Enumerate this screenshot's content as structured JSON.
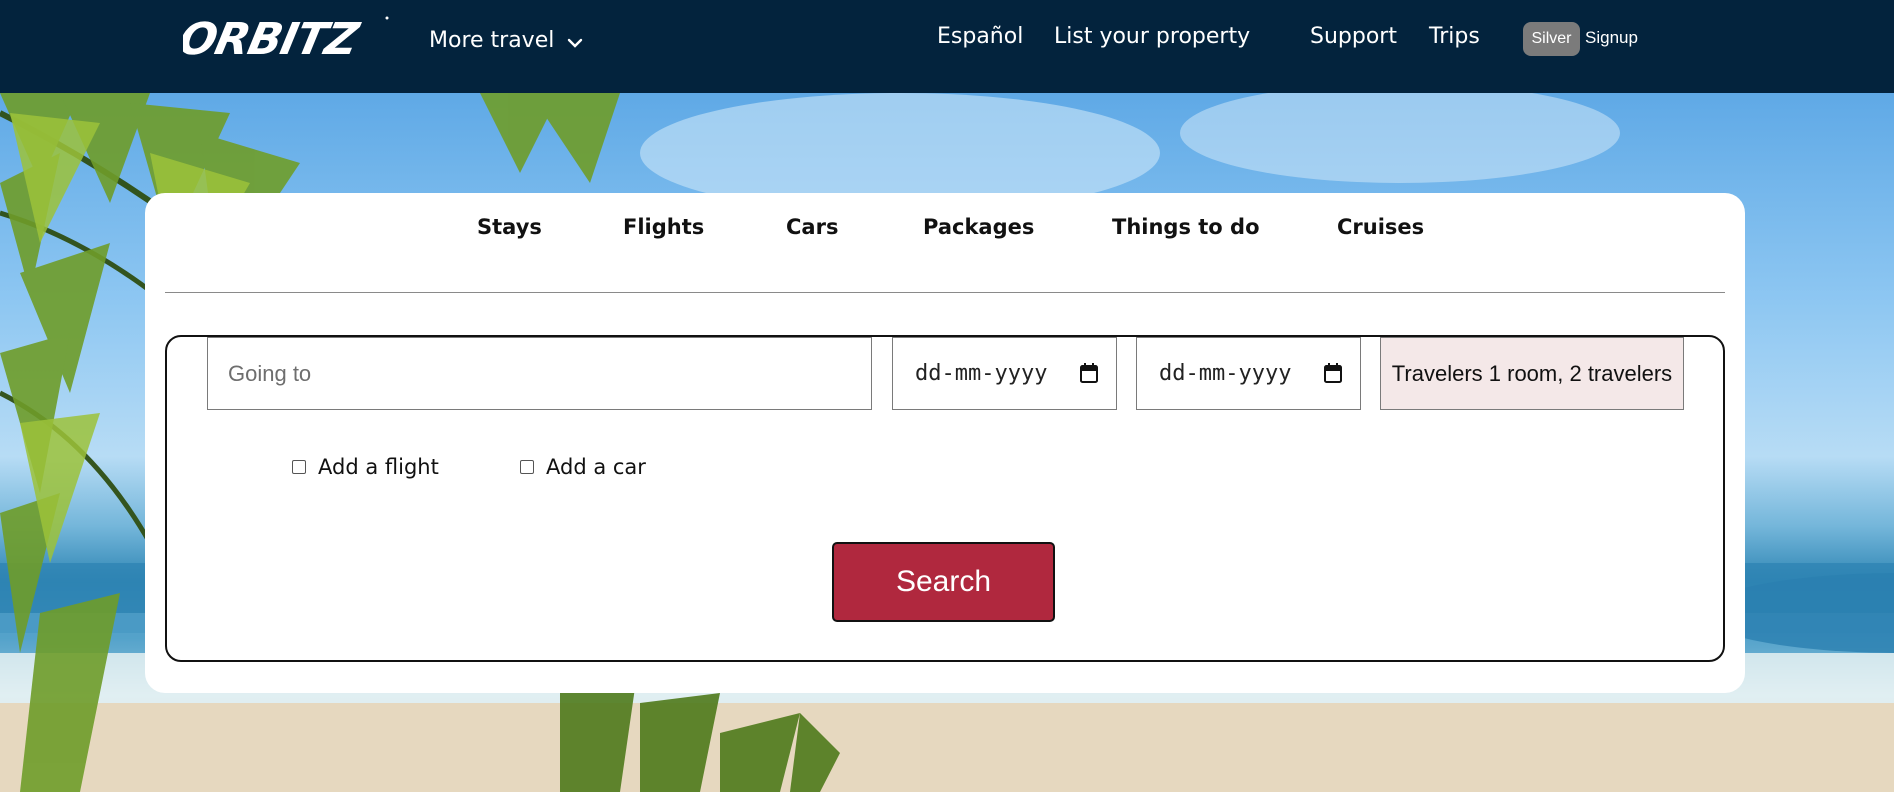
{
  "header": {
    "logo_text": "ORBITZ",
    "more_travel_label": "More travel",
    "links": {
      "espanol": "Español",
      "list_property": "List your property",
      "support": "Support",
      "trips": "Trips"
    },
    "badge_label": "Silver",
    "signup_label": "Signup"
  },
  "tabs": [
    "Stays",
    "Flights",
    "Cars",
    "Packages",
    "Things to do",
    "Cruises"
  ],
  "search_form": {
    "destination_placeholder": "Going to",
    "checkin_placeholder": "dd-mm-yyyy",
    "checkout_placeholder": "dd-mm-yyyy",
    "travelers_label": "Travelers 1 room, 2 travelers",
    "add_flight_label": "Add a flight",
    "add_car_label": "Add a car",
    "search_label": "Search"
  },
  "colors": {
    "header_bg": "#03233d",
    "search_button": "#b0283e",
    "travelers_bg": "#f4e8e8",
    "badge_bg": "#7b7b7b"
  },
  "icons": [
    "chevron-down-icon",
    "calendar-icon"
  ]
}
